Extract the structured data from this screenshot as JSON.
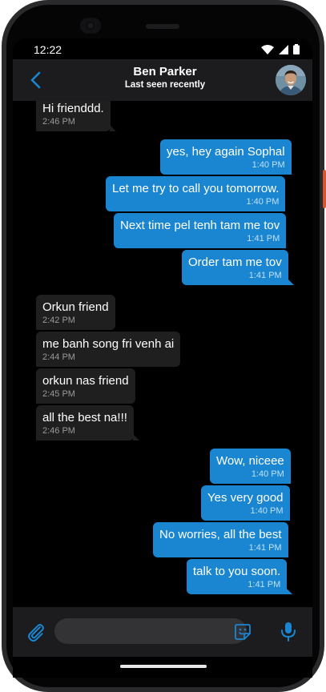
{
  "status_bar": {
    "time": "12:22"
  },
  "header": {
    "contact_name": "Ben Parker",
    "contact_status": "Last seen recently"
  },
  "messages": [
    {
      "dir": "in",
      "text": "Hi frienddd.",
      "time": "2:46 PM"
    },
    {
      "dir": "out",
      "text": "yes, hey again Sophal",
      "time": "1:40 PM"
    },
    {
      "dir": "out",
      "text": "Let me try to call you tomorrow.",
      "time": "1:40 PM"
    },
    {
      "dir": "out",
      "text": "Next time pel tenh tam me tov",
      "time": "1:41 PM"
    },
    {
      "dir": "out",
      "text": "Order tam me tov",
      "time": "1:41 PM"
    },
    {
      "dir": "in",
      "text": "Orkun friend",
      "time": "2:42 PM"
    },
    {
      "dir": "in",
      "text": "me banh song fri venh ai",
      "time": "2:44 PM"
    },
    {
      "dir": "in",
      "text": "orkun nas friend",
      "time": "2:45 PM"
    },
    {
      "dir": "in",
      "text": "all the best na!!!",
      "time": "2:46 PM"
    },
    {
      "dir": "out",
      "text": "Wow, niceee",
      "time": "1:40 PM"
    },
    {
      "dir": "out",
      "text": "Yes very good",
      "time": "1:40 PM"
    },
    {
      "dir": "out",
      "text": "No worries, all the best",
      "time": "1:41 PM"
    },
    {
      "dir": "out",
      "text": "talk to you soon.",
      "time": "1:41 PM"
    }
  ],
  "input": {
    "placeholder": ""
  },
  "icons": {
    "back": "chevron-left-icon",
    "attach": "paperclip-icon",
    "sticker": "sticker-icon",
    "mic": "microphone-icon"
  },
  "colors": {
    "accent": "#1a86d2",
    "incoming_bubble": "#1f1f1f",
    "header_bg": "#1c1c1e",
    "background": "#000000"
  }
}
